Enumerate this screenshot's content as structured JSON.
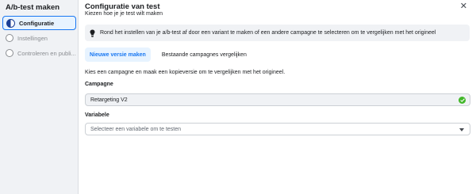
{
  "sidebar": {
    "title": "A/b-test maken",
    "steps": [
      {
        "label": "Configuratie",
        "state": "active"
      },
      {
        "label": "Instellingen",
        "state": "pending"
      },
      {
        "label": "Controleren en publi...",
        "state": "pending"
      }
    ]
  },
  "header": {
    "title": "Configuratie van test",
    "subtitle": "Kiezen hoe je je test wilt maken",
    "close_icon": "close-icon"
  },
  "info_banner": {
    "icon": "lightbulb-icon",
    "text": "Rond het instellen van je a/b-test af door een variant te maken of een andere campagne te selecteren om te vergelijken met het origineel"
  },
  "tabs": [
    {
      "label": "Nieuwe versie maken",
      "active": true
    },
    {
      "label": "Bestaande campagnes vergelijken",
      "active": false
    }
  ],
  "description": "Kies een campagne en maak een kopieversie om te vergelijken met het origineel.",
  "campaign": {
    "label": "Campagne",
    "value": "Retargeting V2",
    "status_icon": "check-circle-icon"
  },
  "variable": {
    "label": "Variabele",
    "placeholder": "Selecteer een variabele om te testen",
    "dropdown_icon": "caret-down-icon"
  },
  "colors": {
    "accent": "#1877f2",
    "accent_bg": "#e7f3ff",
    "success": "#42b72a",
    "sidebar_bg": "#f0f2f5"
  }
}
